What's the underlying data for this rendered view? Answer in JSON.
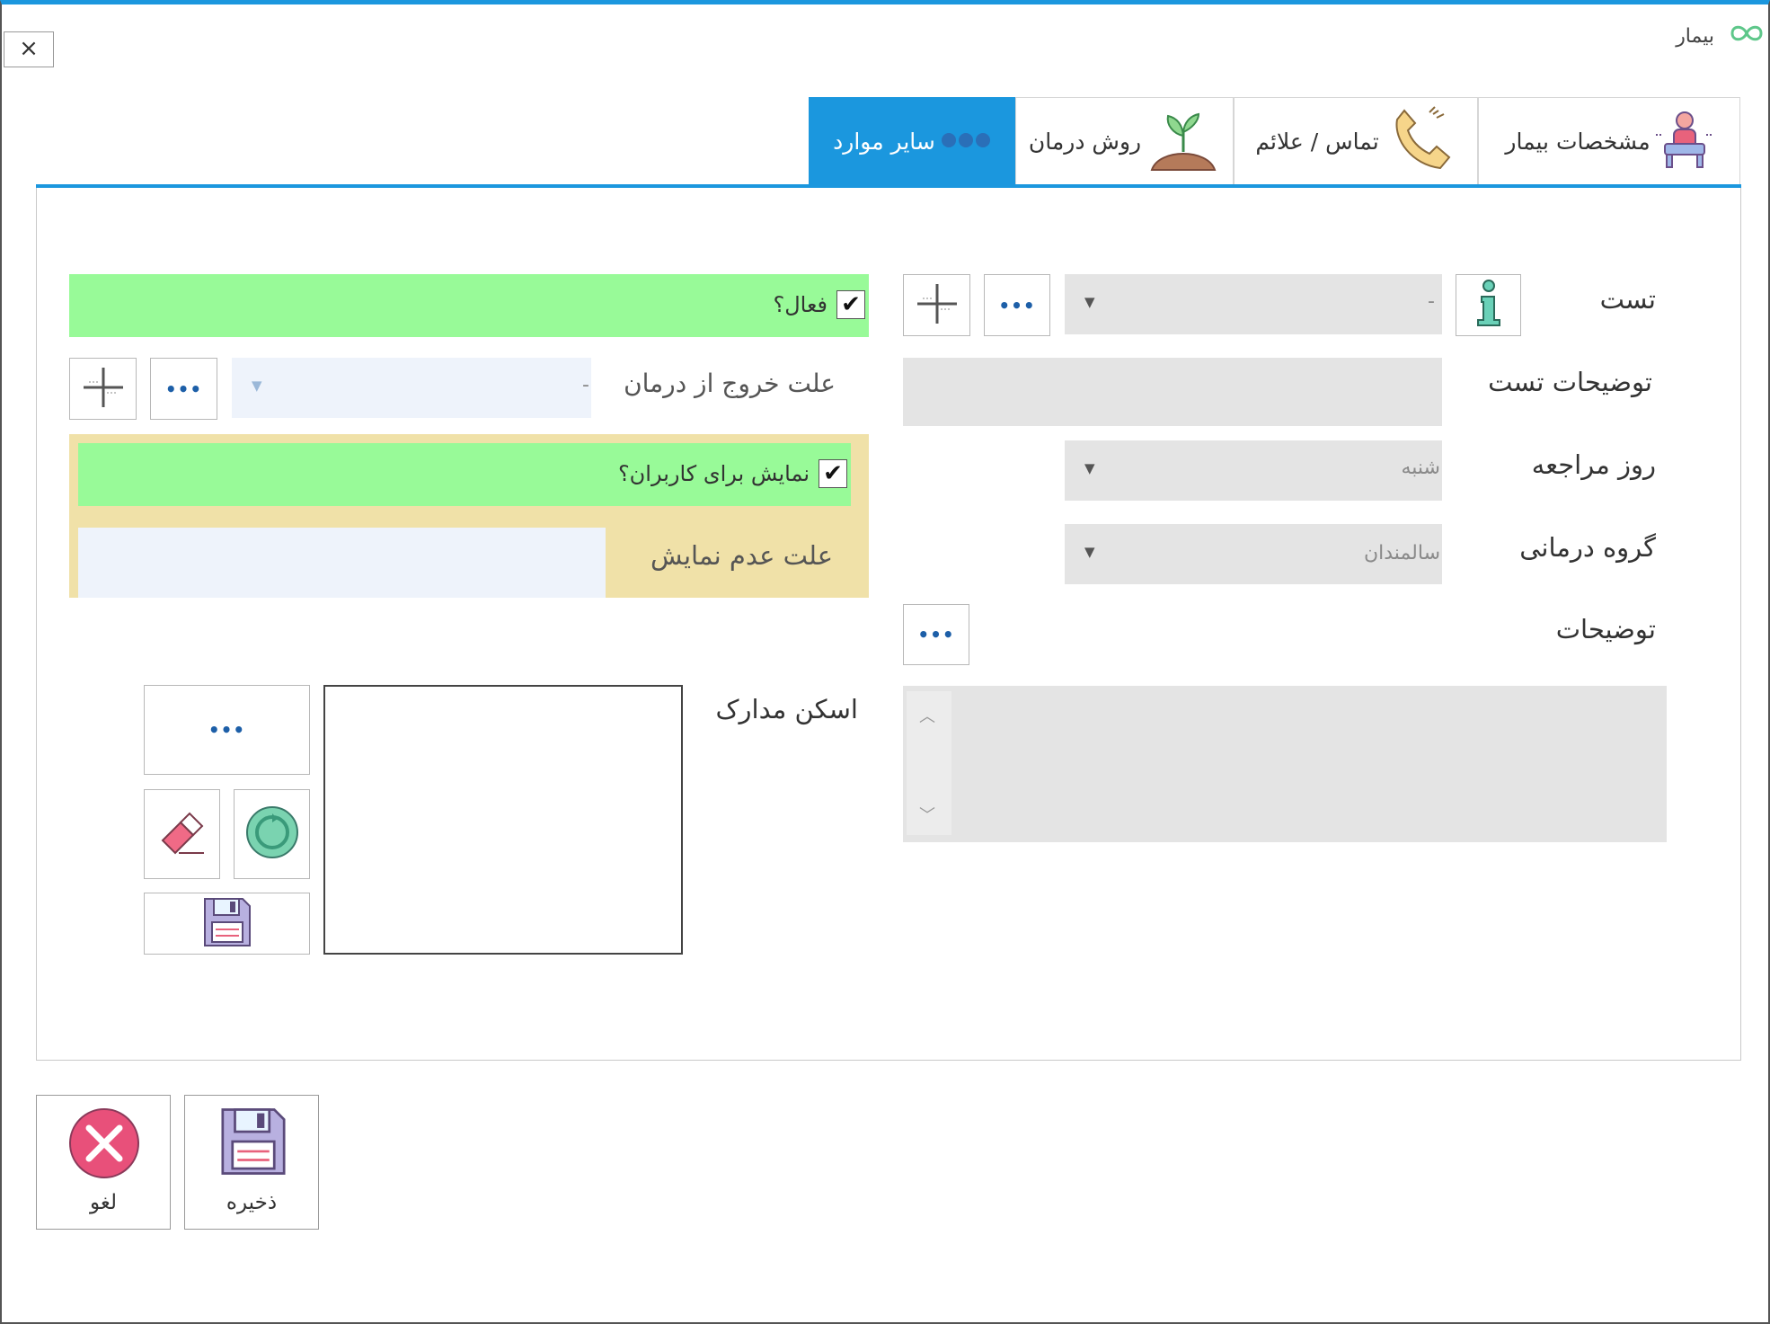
{
  "window": {
    "title": "بیمار",
    "close_label": "×"
  },
  "tabs": [
    {
      "label": "مشخصات بیمار",
      "icon": "patient-sitting-icon",
      "active": false
    },
    {
      "label": "تماس / علائم",
      "icon": "phone-icon",
      "active": false
    },
    {
      "label": "روش درمان",
      "icon": "plant-sprout-icon",
      "active": false
    },
    {
      "label": "سایر موارد",
      "icon": "three-dots-icon",
      "active": true
    }
  ],
  "form": {
    "test": {
      "label": "تست",
      "value": "-"
    },
    "test_description": {
      "label": "توضیحات تست",
      "value": ""
    },
    "visit_day": {
      "label": "روز مراجعه",
      "value": "شنبه"
    },
    "treatment_group": {
      "label": "گروه درمانی",
      "value": "سالمندان"
    },
    "description": {
      "label": "توضیحات",
      "value": ""
    },
    "active": {
      "label": "فعال؟",
      "checked": true
    },
    "exit_reason": {
      "label": "علت خروج از درمان",
      "value": "-"
    },
    "show_to_users": {
      "label": "نمایش برای کاربران؟",
      "checked": true
    },
    "no_show_reason": {
      "label": "علت عدم نمایش",
      "value": ""
    },
    "scan_documents": {
      "label": "اسکن مدارک"
    },
    "check_mark": "✔",
    "dots_glyph": "•••",
    "dropdown_arrow": "▼",
    "scroll_up": "︿",
    "scroll_down": "﹀"
  },
  "footer": {
    "save_label": "ذخیره",
    "cancel_label": "لغو"
  },
  "colors": {
    "accent": "#1b97de",
    "green_bar": "#98fa98",
    "beige_panel": "#f0e1a8",
    "field_gray": "#e4e4e4",
    "cancel_red": "#e8507a"
  }
}
